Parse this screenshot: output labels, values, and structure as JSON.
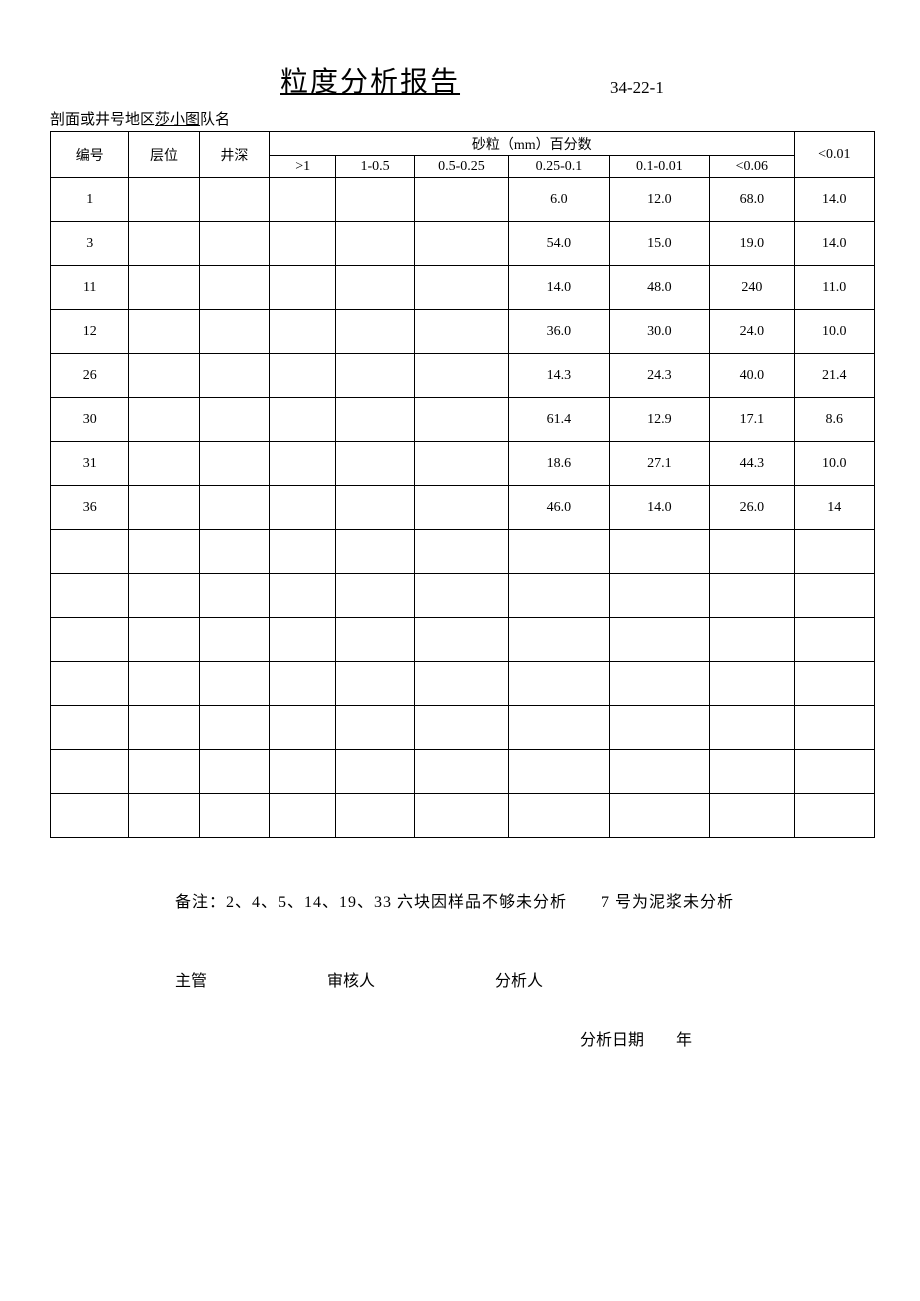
{
  "title": "粒度分析报告",
  "report_no": "34-22-1",
  "meta": {
    "prefix": "剖面或井号地区",
    "location": "莎小图",
    "suffix": "队名"
  },
  "headers": {
    "id": "编号",
    "layer": "层位",
    "depth": "井深",
    "sand_group": "砂粒（mm）百分数",
    "lt001": "<0.01",
    "cols": [
      ">1",
      "1-0.5",
      "0.5-0.25",
      "0.25-0.1",
      "0.1-0.01",
      "<0.06"
    ]
  },
  "rows": [
    {
      "id": "1",
      "layer": "",
      "depth": "",
      "c": [
        "",
        "",
        "",
        "6.0",
        "12.0",
        "68.0"
      ],
      "lt001": "14.0"
    },
    {
      "id": "3",
      "layer": "",
      "depth": "",
      "c": [
        "",
        "",
        "",
        "54.0",
        "15.0",
        "19.0"
      ],
      "lt001": "14.0"
    },
    {
      "id": "11",
      "layer": "",
      "depth": "",
      "c": [
        "",
        "",
        "",
        "14.0",
        "48.0",
        "240"
      ],
      "lt001": "11.0"
    },
    {
      "id": "12",
      "layer": "",
      "depth": "",
      "c": [
        "",
        "",
        "",
        "36.0",
        "30.0",
        "24.0"
      ],
      "lt001": "10.0"
    },
    {
      "id": "26",
      "layer": "",
      "depth": "",
      "c": [
        "",
        "",
        "",
        "14.3",
        "24.3",
        "40.0"
      ],
      "lt001": "21.4"
    },
    {
      "id": "30",
      "layer": "",
      "depth": "",
      "c": [
        "",
        "",
        "",
        "61.4",
        "12.9",
        "17.1"
      ],
      "lt001": "8.6"
    },
    {
      "id": "31",
      "layer": "",
      "depth": "",
      "c": [
        "",
        "",
        "",
        "18.6",
        "27.1",
        "44.3"
      ],
      "lt001": "10.0"
    },
    {
      "id": "36",
      "layer": "",
      "depth": "",
      "c": [
        "",
        "",
        "",
        "46.0",
        "14.0",
        "26.0"
      ],
      "lt001": "14"
    }
  ],
  "empty_rows": 7,
  "notes": "备注：2、4、5、14、19、33 六块因样品不够未分析　　7 号为泥浆未分析",
  "signatures": {
    "s1": "主管",
    "s2": "审核人",
    "s3": "分析人"
  },
  "date_line": "分析日期　　年"
}
